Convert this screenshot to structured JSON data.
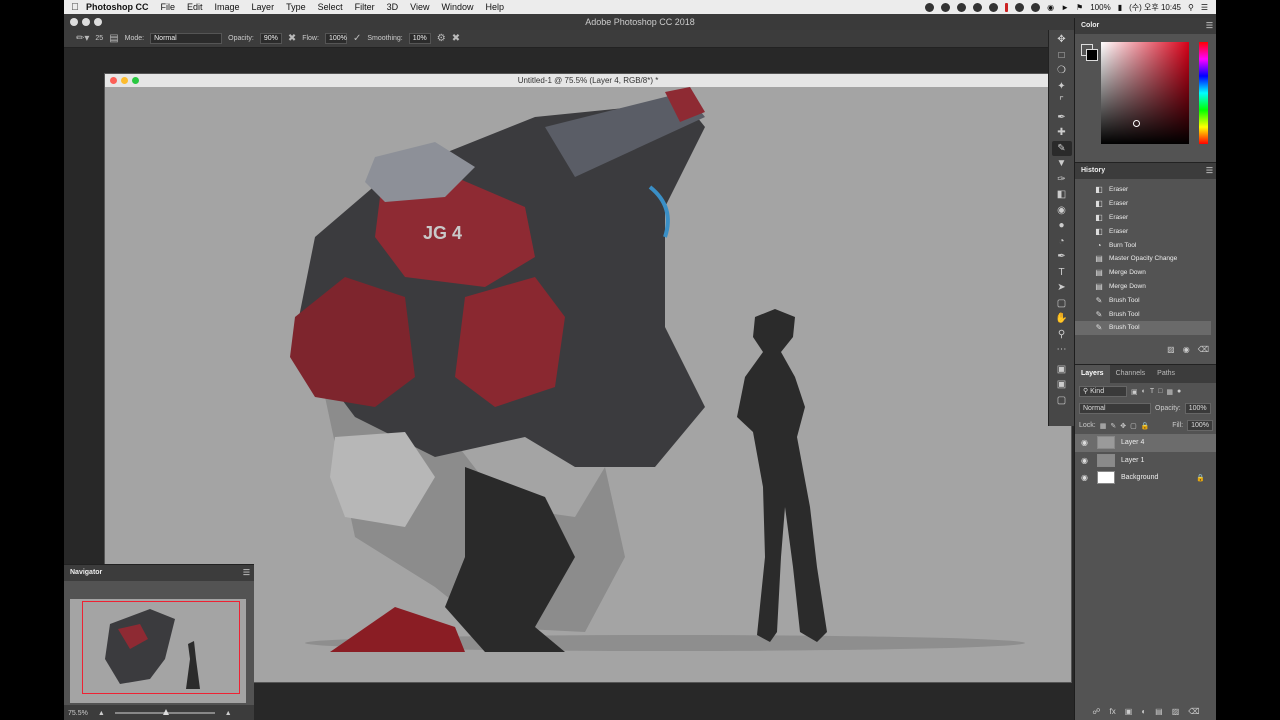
{
  "menubar": {
    "app": "Photoshop CC",
    "items": [
      "File",
      "Edit",
      "Image",
      "Layer",
      "Type",
      "Select",
      "Filter",
      "3D",
      "View",
      "Window",
      "Help"
    ],
    "battery": "100%",
    "clock": "(수) 오후 10:45"
  },
  "app_title": "Adobe Photoshop CC 2018",
  "options": {
    "brush_size": "25",
    "mode_label": "Mode:",
    "mode_value": "Normal",
    "opacity_label": "Opacity:",
    "opacity_value": "90%",
    "flow_label": "Flow:",
    "flow_value": "100%",
    "smoothing_label": "Smoothing:",
    "smoothing_value": "10%"
  },
  "document": {
    "title": "Untitled-1 @ 75.5% (Layer 4, RGB/8*) *"
  },
  "navigator": {
    "title": "Navigator",
    "zoom": "75.5%"
  },
  "tools": [
    "move-icon",
    "marquee-icon",
    "lasso-icon",
    "magic-wand-icon",
    "crop-icon",
    "eyedropper-icon",
    "healing-icon",
    "brush-icon",
    "stamp-icon",
    "history-brush-icon",
    "eraser-icon",
    "bucket-icon",
    "blur-icon",
    "dodge-icon",
    "pen-icon",
    "type-icon",
    "path-select-icon",
    "rectangle-icon",
    "hand-icon",
    "zoom-icon",
    "more-icon"
  ],
  "color_panel": {
    "title": "Color",
    "hue": "#d80018"
  },
  "history": {
    "title": "History",
    "items": [
      {
        "icon": "eraser",
        "label": "Eraser"
      },
      {
        "icon": "eraser",
        "label": "Eraser"
      },
      {
        "icon": "eraser",
        "label": "Eraser"
      },
      {
        "icon": "eraser",
        "label": "Eraser"
      },
      {
        "icon": "burn",
        "label": "Burn Tool"
      },
      {
        "icon": "doc",
        "label": "Master Opacity Change"
      },
      {
        "icon": "doc",
        "label": "Merge Down"
      },
      {
        "icon": "doc",
        "label": "Merge Down"
      },
      {
        "icon": "brush",
        "label": "Brush Tool"
      },
      {
        "icon": "brush",
        "label": "Brush Tool"
      },
      {
        "icon": "brush",
        "label": "Brush Tool"
      }
    ]
  },
  "layers_panel": {
    "tabs": [
      "Layers",
      "Channels",
      "Paths"
    ],
    "filter": "Kind",
    "blend_mode": "Normal",
    "opacity_label": "Opacity:",
    "opacity_value": "100%",
    "lock_label": "Lock:",
    "fill_label": "Fill:",
    "fill_value": "100%",
    "layers": [
      {
        "name": "Layer 4",
        "selected": true,
        "thumb": "#9a9a9a"
      },
      {
        "name": "Layer 1",
        "selected": false,
        "thumb": "#8a8a8a"
      },
      {
        "name": "Background",
        "selected": false,
        "thumb": "#ffffff",
        "locked": true
      }
    ]
  }
}
